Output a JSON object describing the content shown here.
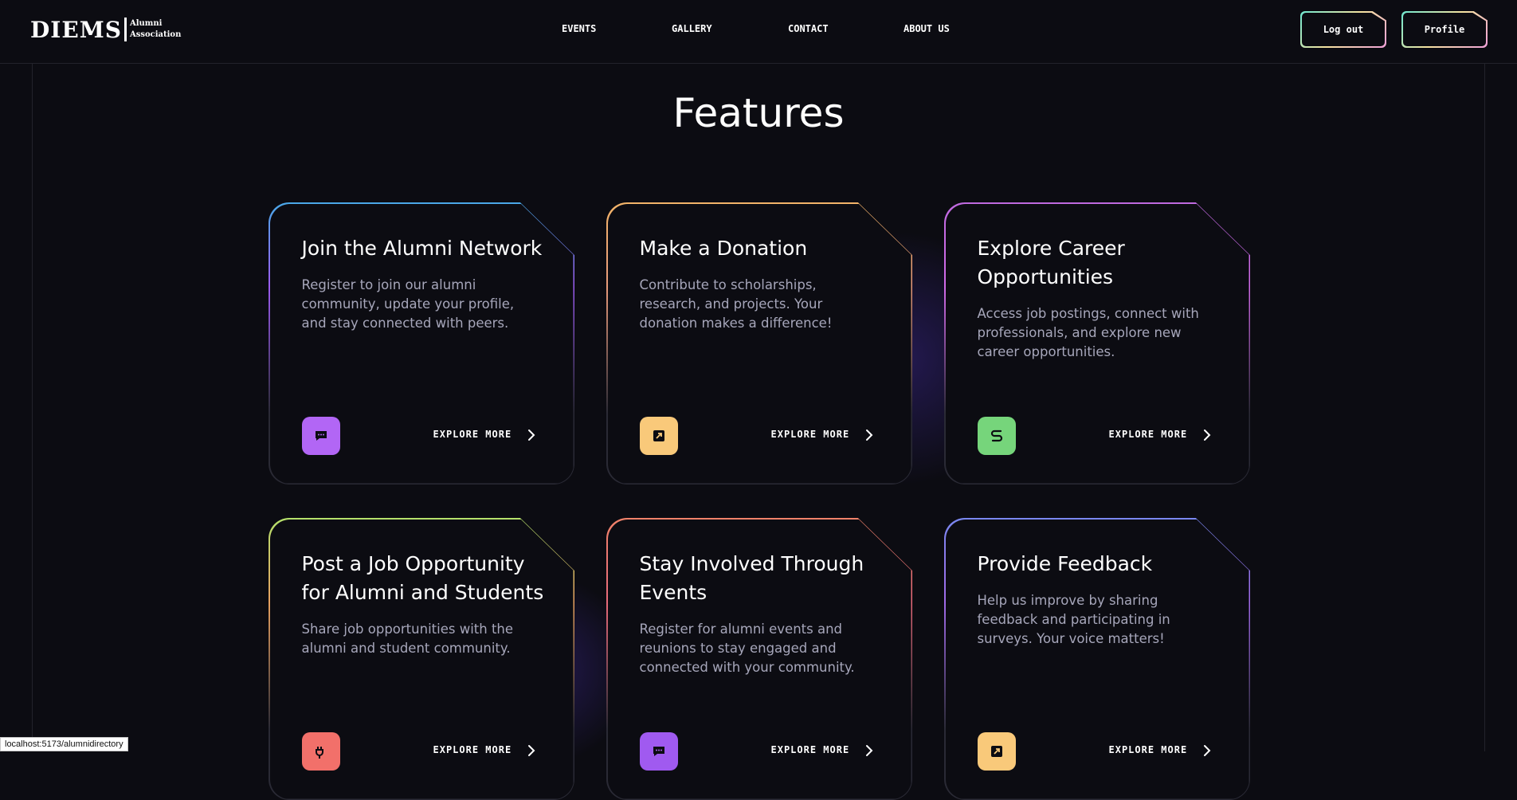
{
  "brand": {
    "main": "DIEMS",
    "sub_line1": "Alumni",
    "sub_line2": "Association"
  },
  "nav": {
    "items": [
      {
        "label": "EVENTS"
      },
      {
        "label": "GALLERY"
      },
      {
        "label": "CONTACT"
      },
      {
        "label": "ABOUT US"
      }
    ]
  },
  "header_buttons": {
    "logout": "Log out",
    "profile": "Profile"
  },
  "features": {
    "title": "Features",
    "cards": [
      {
        "title": "Join the Alumni Network",
        "description": "Register to join our alumni community, update your profile, and stay connected with peers.",
        "cta": "EXPLORE MORE",
        "icon": "chat-icon",
        "icon_color": "#b266f5",
        "border_gradient": [
          "#4aa8e8",
          "#9b5cf0",
          "#2a2a35"
        ]
      },
      {
        "title": "Make a Donation",
        "description": "Contribute to scholarships, research, and projects. Your donation makes a difference!",
        "cta": "EXPLORE MORE",
        "icon": "external-link-icon",
        "icon_color": "#f9c97a",
        "border_gradient": [
          "#f3b469",
          "#e79a7b",
          "#2a2a35"
        ]
      },
      {
        "title": "Explore Career Opportunities",
        "description": "Access job postings, connect with professionals, and explore new career opportunities.",
        "cta": "EXPLORE MORE",
        "icon": "route-icon",
        "icon_color": "#76d57b",
        "border_gradient": [
          "#c06ae0",
          "#d16ae8",
          "#2a2a35"
        ]
      },
      {
        "title": "Post a Job Opportunity for Alumni and Students",
        "description": "Share job opportunities with the alumni and student community.",
        "cta": "EXPLORE MORE",
        "icon": "plug-icon",
        "icon_color": "#f2706a",
        "border_gradient": [
          "#b6e26c",
          "#e6a060",
          "#2a2a35"
        ]
      },
      {
        "title": "Stay Involved Through Events",
        "description": "Register for alumni events and reunions to stay engaged and connected with your community.",
        "cta": "EXPLORE MORE",
        "icon": "chat-icon",
        "icon_color": "#a05af0",
        "border_gradient": [
          "#f0826a",
          "#e76a7a",
          "#2a2a35"
        ]
      },
      {
        "title": "Provide Feedback",
        "description": "Help us improve by sharing feedback and participating in surveys. Your voice matters!",
        "cta": "EXPLORE MORE",
        "icon": "external-link-icon",
        "icon_color": "#f9c97a",
        "border_gradient": [
          "#7a88f0",
          "#a06ae8",
          "#2a2a35"
        ]
      }
    ]
  },
  "status_bar": {
    "url": "localhost:5173/alumnidirectory"
  }
}
